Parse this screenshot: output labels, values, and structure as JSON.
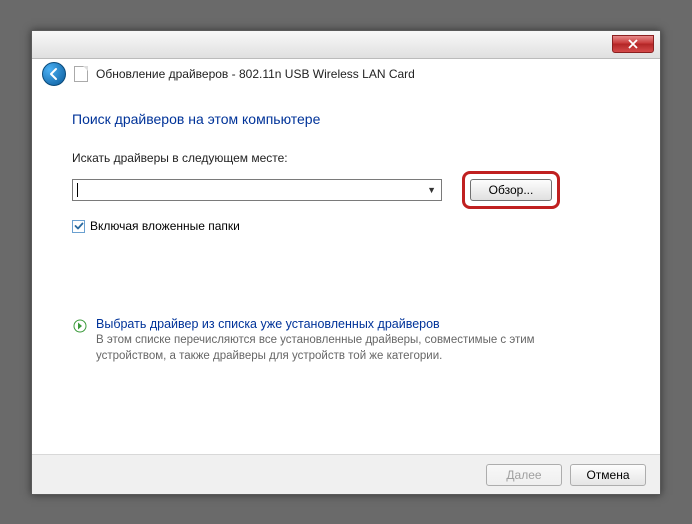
{
  "window": {
    "title": "Обновление драйверов - 802.11n USB Wireless LAN Card"
  },
  "main": {
    "heading": "Поиск драйверов на этом компьютере",
    "path_label": "Искать драйверы в следующем месте:",
    "path_value": "",
    "browse_label": "Обзор...",
    "include_subfolders_label": "Включая вложенные папки",
    "include_subfolders_checked": true,
    "pick_link_title": "Выбрать драйвер из списка уже установленных драйверов",
    "pick_link_desc": "В этом списке перечисляются все установленные драйверы, совместимые с этим устройством, а также драйверы для устройств той же категории."
  },
  "footer": {
    "next_label": "Далее",
    "cancel_label": "Отмена"
  }
}
